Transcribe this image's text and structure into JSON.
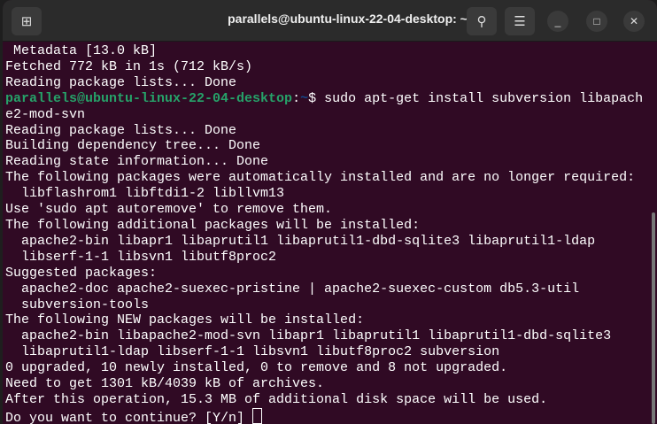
{
  "window": {
    "title": "parallels@ubuntu-linux-22-04-desktop: ~"
  },
  "terminal": {
    "lines_before": [
      "Metadata [13.0 kB]",
      "Fetched 772 kB in 1s (712 kB/s)",
      "Reading package lists... Done"
    ],
    "prompt": {
      "user_host": "parallels@ubuntu-linux-22-04-desktop",
      "path": "~",
      "symbol": "$",
      "command": " sudo apt-get install subversion libapach"
    },
    "lines_after": [
      "e2-mod-svn",
      "Reading package lists... Done",
      "Building dependency tree... Done",
      "Reading state information... Done",
      "The following packages were automatically installed and are no longer required:",
      "  libflashrom1 libftdi1-2 libllvm13",
      "Use 'sudo apt autoremove' to remove them.",
      "The following additional packages will be installed:",
      "  apache2-bin libapr1 libaprutil1 libaprutil1-dbd-sqlite3 libaprutil1-ldap",
      "  libserf-1-1 libsvn1 libutf8proc2",
      "Suggested packages:",
      "  apache2-doc apache2-suexec-pristine | apache2-suexec-custom db5.3-util",
      "  subversion-tools",
      "The following NEW packages will be installed:",
      "  apache2-bin libapache2-mod-svn libapr1 libaprutil1 libaprutil1-dbd-sqlite3",
      "  libaprutil1-ldap libserf-1-1 libsvn1 libutf8proc2 subversion",
      "0 upgraded, 10 newly installed, 0 to remove and 8 not upgraded.",
      "Need to get 1301 kB/4039 kB of archives.",
      "After this operation, 15.3 MB of additional disk space will be used."
    ],
    "last_prompt": "Do you want to continue? [Y/n] "
  }
}
